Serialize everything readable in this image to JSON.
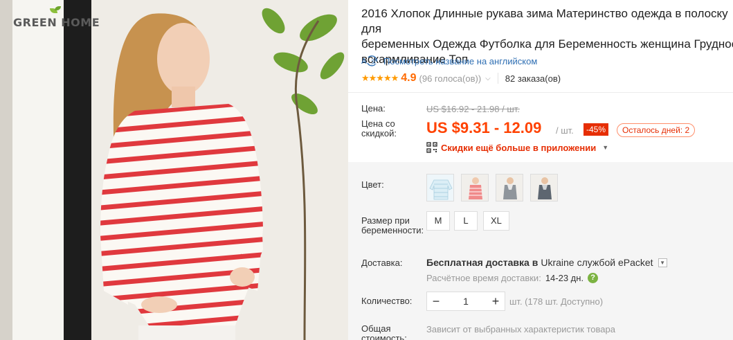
{
  "photo": {
    "watermark": "GREEN HOME"
  },
  "product": {
    "title": "2016 Хлопок Длинные рукава зима Материнство одежда в полоску для\nбеременных Одежда Футболка для Беременность женщина Грудное\nвскармливание Топ",
    "translate_link": "Посмотреть название на английском",
    "rating_stars": "★★★★★",
    "rating_value": "4.9",
    "votes": "(96 голоса(ов))",
    "orders": "82 заказа(ов)"
  },
  "price": {
    "label": "Цена:",
    "original": "US $16.92 - 21.98 / шт.",
    "discount_label": "Цена со скидкой:",
    "discounted": "US $9.31 - 12.09",
    "unit": "/ шт.",
    "discount_badge": "-45%",
    "days_left": "Осталось дней: 2",
    "app_discount": "Скидки ещё больше в приложении"
  },
  "color": {
    "label": "Цвет:",
    "options": [
      "white-blue-stripe",
      "pink-striped",
      "grey",
      "dark-grey"
    ]
  },
  "size": {
    "label": "Размер при беременности:",
    "options": [
      "M",
      "L",
      "XL"
    ]
  },
  "shipping": {
    "label": "Доставка:",
    "text_prefix": "Бесплатная доставка в",
    "country": "Ukraine",
    "text_suffix": "службой ePacket",
    "estimate_label": "Расчётное время доставки:",
    "estimate_days": "14-23 дн."
  },
  "quantity": {
    "label": "Количество:",
    "value": "1",
    "stock": "шт. (178 шт. Доступно)"
  },
  "total": {
    "label": "Общая стоимость:",
    "value": "Зависит от выбранных характеристик товара"
  },
  "colors": {
    "accent": "#ff4200",
    "badge": "#e62e04",
    "link": "#2f6fb3",
    "star": "#ff9a00",
    "stripe": "#e0393e"
  }
}
